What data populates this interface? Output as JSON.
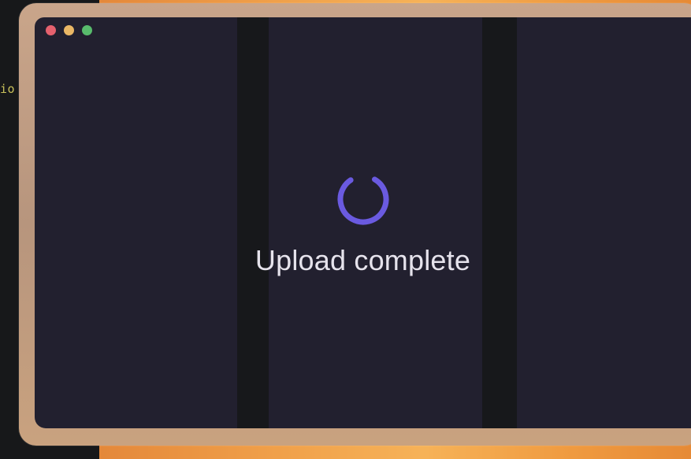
{
  "background": {
    "code_fragment": "io",
    "code_color": "#c8c05a",
    "backdrop_color": "#f0a04a"
  },
  "window": {
    "background_color": "#22202f",
    "controls": [
      {
        "name": "close-icon",
        "color": "#e5616e"
      },
      {
        "name": "minimize-icon",
        "color": "#eab765"
      },
      {
        "name": "maximize-icon",
        "color": "#58bb6c"
      }
    ]
  },
  "status": {
    "spinner_icon": "loading-spinner-icon",
    "spinner_color": "#6a5ae0",
    "message": "Upload complete"
  }
}
